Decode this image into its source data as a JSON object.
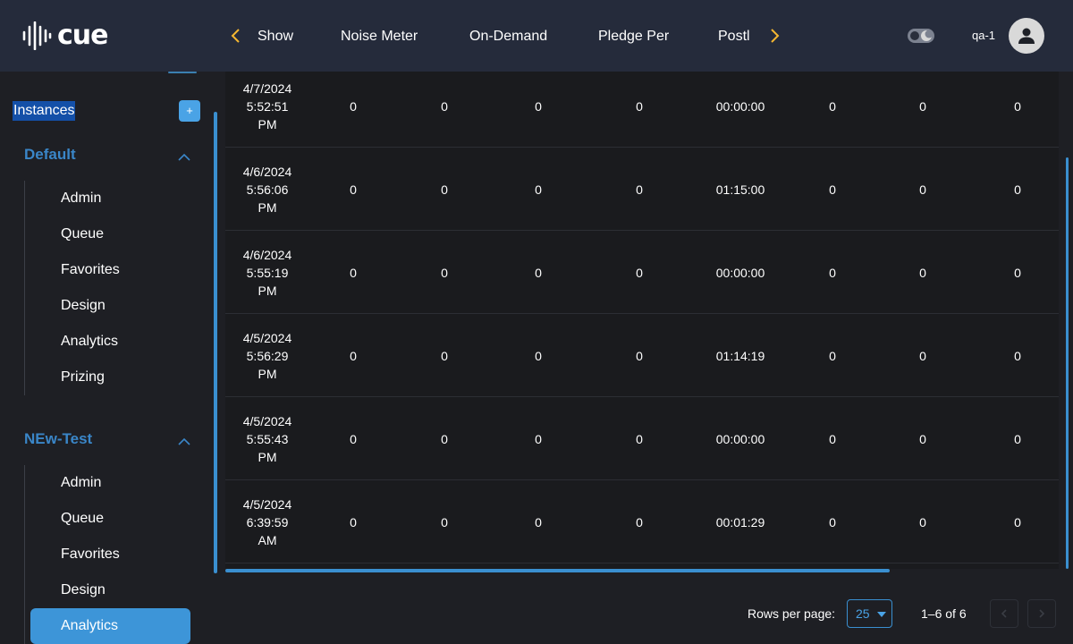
{
  "app": {
    "logo_text": "cue"
  },
  "header": {
    "tabs": [
      {
        "label": "Show"
      },
      {
        "label": "Noise Meter"
      },
      {
        "label": "On-Demand"
      },
      {
        "label": "Pledge Per"
      },
      {
        "label": "Postl"
      }
    ],
    "user": {
      "name": "qa-1"
    },
    "icons": {
      "prev": "chevron-left-icon",
      "next": "chevron-right-icon",
      "theme": "theme-toggle-icon",
      "avatar": "user-avatar-icon"
    }
  },
  "sidebar": {
    "instances_label": "Instances",
    "add_label": "+",
    "groups": [
      {
        "title": "Default",
        "items": [
          {
            "label": "Admin"
          },
          {
            "label": "Queue"
          },
          {
            "label": "Favorites"
          },
          {
            "label": "Design"
          },
          {
            "label": "Analytics"
          },
          {
            "label": "Prizing"
          }
        ]
      },
      {
        "title": "NEw-Test",
        "items": [
          {
            "label": "Admin"
          },
          {
            "label": "Queue"
          },
          {
            "label": "Favorites"
          },
          {
            "label": "Design"
          },
          {
            "label": "Analytics",
            "active": true
          }
        ]
      }
    ]
  },
  "table": {
    "rows": [
      {
        "date": "4/7/2024",
        "time": "5:52:51",
        "ampm": "PM",
        "c1": "0",
        "c2": "0",
        "c3": "0",
        "c4": "0",
        "duration": "00:00:00",
        "c5": "0",
        "c6": "0",
        "c7": "0"
      },
      {
        "date": "4/6/2024",
        "time": "5:56:06",
        "ampm": "PM",
        "c1": "0",
        "c2": "0",
        "c3": "0",
        "c4": "0",
        "duration": "01:15:00",
        "c5": "0",
        "c6": "0",
        "c7": "0"
      },
      {
        "date": "4/6/2024",
        "time": "5:55:19",
        "ampm": "PM",
        "c1": "0",
        "c2": "0",
        "c3": "0",
        "c4": "0",
        "duration": "00:00:00",
        "c5": "0",
        "c6": "0",
        "c7": "0"
      },
      {
        "date": "4/5/2024",
        "time": "5:56:29",
        "ampm": "PM",
        "c1": "0",
        "c2": "0",
        "c3": "0",
        "c4": "0",
        "duration": "01:14:19",
        "c5": "0",
        "c6": "0",
        "c7": "0"
      },
      {
        "date": "4/5/2024",
        "time": "5:55:43",
        "ampm": "PM",
        "c1": "0",
        "c2": "0",
        "c3": "0",
        "c4": "0",
        "duration": "00:00:00",
        "c5": "0",
        "c6": "0",
        "c7": "0"
      },
      {
        "date": "4/5/2024",
        "time": "6:39:59",
        "ampm": "AM",
        "c1": "0",
        "c2": "0",
        "c3": "0",
        "c4": "0",
        "duration": "00:01:29",
        "c5": "0",
        "c6": "0",
        "c7": "0"
      }
    ]
  },
  "pagination": {
    "rows_per_page_label": "Rows per page:",
    "rows_per_page_value": "25",
    "range_text": "1–6 of 6"
  },
  "colors": {
    "accent": "#3d95d8",
    "header_bg": "#252b3b",
    "group_title": "#3a86c8",
    "nav_arrow": "#f5b731"
  }
}
